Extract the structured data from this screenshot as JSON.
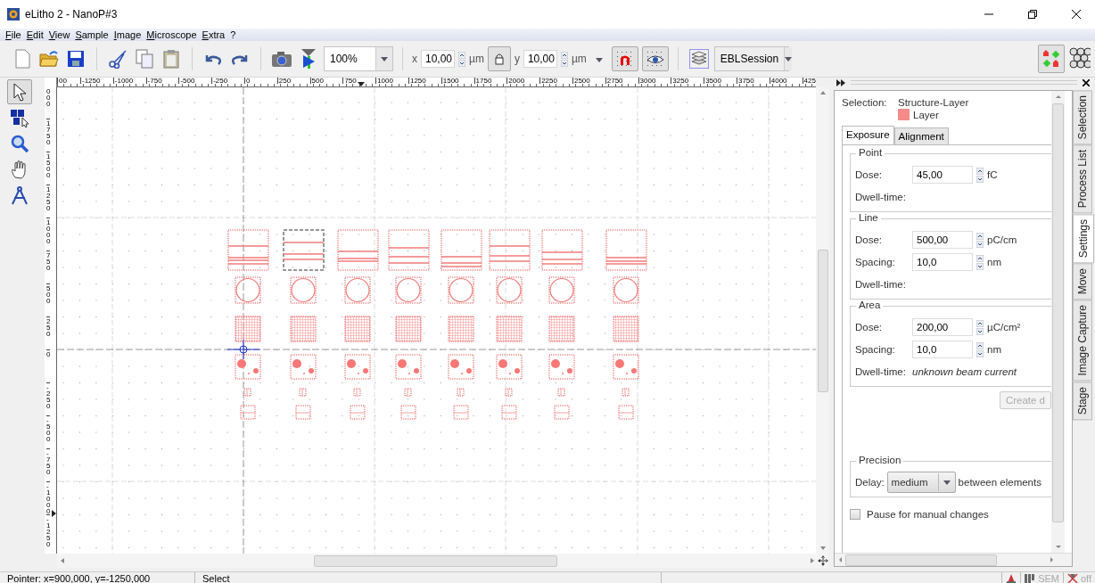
{
  "window": {
    "title": "eLitho 2 - NanoP#3"
  },
  "menu": [
    "File",
    "Edit",
    "View",
    "Sample",
    "Image",
    "Microscope",
    "Extra",
    "?"
  ],
  "toolbar": {
    "zoom": "100%",
    "x_label": "x",
    "x_value": "10,00",
    "x_unit": "µm",
    "lock_on": true,
    "y_label": "y",
    "y_value": "10,00",
    "y_unit": "µm",
    "snap_on": true,
    "grid_on": true,
    "session": "EBLSession",
    "structure_view_on": true
  },
  "tools": [
    {
      "kind": "pointer",
      "selected": true
    },
    {
      "kind": "numbered",
      "selected": false
    },
    {
      "kind": "zoom",
      "selected": false
    },
    {
      "kind": "hand",
      "selected": false
    },
    {
      "kind": "compass",
      "selected": false
    }
  ],
  "rulers": {
    "horizontal": [
      "00",
      "-1250",
      "-1000",
      "-750",
      "-500",
      "-250",
      "0",
      "250",
      "500",
      "750",
      "1000",
      "1250",
      "1500",
      "1750",
      "2000",
      "2250",
      "2500",
      "2750",
      "3000",
      "3250",
      "3500",
      "3750",
      "4000",
      "425"
    ],
    "vertical": [
      "000",
      "1750",
      "1500",
      "1250",
      "1000",
      "750",
      "500",
      "250",
      "0",
      "-250",
      "-500",
      "-750",
      "-1000",
      "-1250"
    ]
  },
  "canvas": {
    "columns": [
      {
        "selected": false
      },
      {
        "selected": true
      },
      {
        "selected": false
      },
      {
        "selected": false
      },
      {
        "selected": false
      },
      {
        "selected": false
      },
      {
        "selected": false
      },
      {
        "selected": false
      }
    ]
  },
  "panel": {
    "selection_label": "Selection:",
    "selection_name": "Structure-Layer",
    "layer_name": "Layer",
    "tabs": [
      {
        "label": "Exposure",
        "selected": true
      },
      {
        "label": "Alignment",
        "selected": false
      }
    ],
    "groups": [
      {
        "title": "Point",
        "rows": [
          {
            "kind": "spin",
            "label": "Dose:",
            "value": "45,00",
            "unit": "fC"
          },
          {
            "kind": "info",
            "label": "Dwell-time:"
          }
        ]
      },
      {
        "title": "Line",
        "rows": [
          {
            "kind": "spin",
            "label": "Dose:",
            "value": "500,00",
            "unit": "pC/cm"
          },
          {
            "kind": "spin",
            "label": "Spacing:",
            "value": "10,0",
            "unit": "nm"
          },
          {
            "kind": "info",
            "label": "Dwell-time:"
          }
        ]
      },
      {
        "title": "Area",
        "rows": [
          {
            "kind": "spin",
            "label": "Dose:",
            "value": "200,00",
            "unit": "µC/cm²"
          },
          {
            "kind": "spin",
            "label": "Spacing:",
            "value": "10,0",
            "unit": "nm"
          },
          {
            "kind": "info",
            "label": "Dwell-time:",
            "note": "unknown beam current"
          }
        ]
      }
    ],
    "create_button": {
      "label": "Create d",
      "disabled": true
    },
    "precision": {
      "title": "Precision",
      "delay_label": "Delay:",
      "delay_value": "medium",
      "suffix": "between elements"
    },
    "pause": {
      "label": "Pause for manual changes",
      "checked": false
    },
    "side_tabs": [
      {
        "label": "Selection",
        "selected": false
      },
      {
        "label": "Process List",
        "selected": false
      },
      {
        "label": "Settings",
        "selected": true
      },
      {
        "label": "Move",
        "selected": false
      },
      {
        "label": "Image Capture",
        "selected": false
      },
      {
        "label": "Stage",
        "selected": false
      }
    ]
  },
  "status_bar": {
    "pointer": "Pointer: x=900,000, y=-1250,000",
    "mode": "Select",
    "sem": "SEM",
    "sem_disabled": true,
    "beam": "off"
  }
}
